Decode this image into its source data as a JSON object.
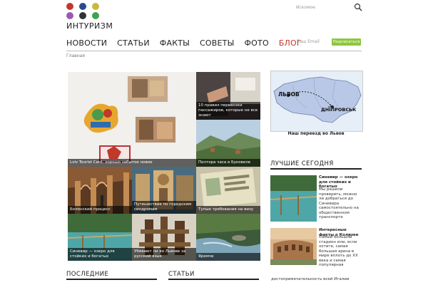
{
  "logo": {
    "text": "ИНТУРИЗМ",
    "dot_colors": [
      "#c0392b",
      "#2c4a8a",
      "#c8b93a",
      "#9b59b6",
      "#333333",
      "#3fa34d"
    ]
  },
  "search": {
    "placeholder": "Искомое"
  },
  "nav": {
    "items": [
      {
        "label": "НОВОСТИ"
      },
      {
        "label": "СТАТЬИ"
      },
      {
        "label": "ФАКТЫ"
      },
      {
        "label": "СОВЕТЫ"
      },
      {
        "label": "ФОТО"
      },
      {
        "label": "БЛОГ"
      }
    ]
  },
  "subscribe": {
    "email_placeholder": "Ваш Email",
    "button_label": "Подписаться"
  },
  "breadcrumb": {
    "label": "Главная"
  },
  "mosaic": {
    "tiles": [
      {
        "caption": "Lviv Tourist Card: хорошо забытое новое"
      },
      {
        "caption": "10 правил перевозки пассажиров, которые не все знают"
      },
      {
        "caption": "Полтора часа в Буковеле"
      },
      {
        "caption": "Болонский процесс"
      },
      {
        "caption": "Путешествие по городским синдромам"
      },
      {
        "caption": "Тупые требования на визу"
      },
      {
        "caption": "Синевир — озеро для стойких и богатых"
      },
      {
        "caption": "Убивают ли во Львове за русский язык"
      },
      {
        "caption": "Яремче"
      }
    ]
  },
  "map_card": {
    "city_left": "ЛЬВОВ",
    "city_right": "ДНІПРОВСЬК",
    "caption": "Наш переезд во Львов"
  },
  "sidebar": {
    "heading": "ЛУЧШИЕ СЕГОДНЯ",
    "items": [
      {
        "title": "Синевир — озеро для стойких и богатых",
        "text": "Мы решили проверить, можно ли добраться до Синевира самостоятельно на общественном транспорте"
      },
      {
        "title": "Интересные факты о Колизее",
        "text": "Самый большой стадион или, если хотите, самая большая арена в мире вплоть до XX века и самая популярная"
      }
    ],
    "tail_text": "достопримечательность всей Италии"
  },
  "bottom": {
    "latest_heading": "ПОСЛЕДНИЕ",
    "articles_heading": "СТАТЬИ"
  }
}
